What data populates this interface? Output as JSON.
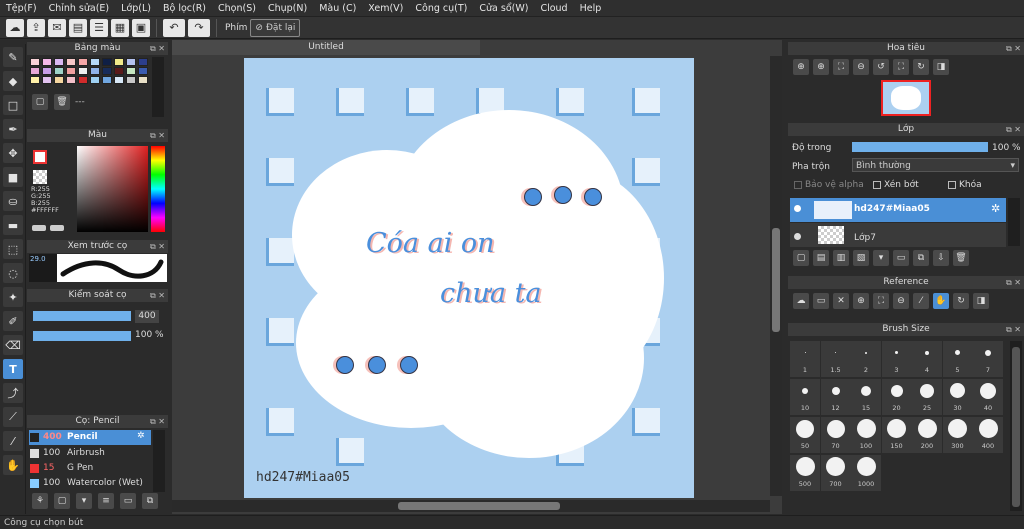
{
  "menu": [
    "Tệp(F)",
    "Chỉnh sửa(E)",
    "Lớp(L)",
    "Bộ lọc(R)",
    "Chọn(S)",
    "Chụp(N)",
    "Màu (C)",
    "Xem(V)",
    "Công cụ(T)",
    "Cửa sổ(W)",
    "Cloud",
    "Help"
  ],
  "toolbar": {
    "phim_label": "Phím",
    "reset_label": "Đặt lại"
  },
  "panels": {
    "palette_title": "Bảng màu",
    "palette_dash": "---",
    "color_title": "Màu",
    "color_values": {
      "r": "R:255",
      "g": "G:255",
      "b": "B:255",
      "hex": "#FFFFFF"
    },
    "brush_preview_title": "Xem trước cọ",
    "brush_preview_size": "29.0",
    "brush_control_title": "Kiểm soát cọ",
    "brush_control": {
      "size": "400",
      "opacity": "100 %"
    },
    "brush_list_title": "Cọ: Pencil",
    "brushes": [
      {
        "size": "400",
        "name": "Pencil",
        "active": true
      },
      {
        "size": "100",
        "name": "Airbrush",
        "active": false
      },
      {
        "size": "15",
        "name": "G Pen",
        "active": false
      },
      {
        "size": "100",
        "name": "Watercolor (Wet)",
        "active": false
      }
    ]
  },
  "canvas": {
    "tab_title": "Untitled",
    "text_line1": "Cóa ai on",
    "text_line2": "chưa ta",
    "watermark": "hd247#Miaa05"
  },
  "navigator": {
    "title": "Hoa tiêu"
  },
  "layers": {
    "title": "Lớp",
    "opacity_label": "Độ trong",
    "opacity_value": "100 %",
    "blend_label": "Pha trộn",
    "blend_value": "Bình thường",
    "protect_alpha": "Bảo vệ alpha",
    "clipping": "Xén bớt",
    "lock": "Khóa",
    "list": [
      {
        "name": "hd247#Miaa05",
        "active": true
      },
      {
        "name": "Lớp7",
        "active": false
      }
    ]
  },
  "reference": {
    "title": "Reference"
  },
  "brush_size": {
    "title": "Brush Size",
    "sizes": [
      "1",
      "1.5",
      "2",
      "3",
      "4",
      "5",
      "7",
      "10",
      "12",
      "15",
      "20",
      "25",
      "30",
      "40",
      "50",
      "70",
      "100",
      "150",
      "200",
      "300",
      "400",
      "500",
      "700",
      "1000"
    ]
  },
  "status": {
    "text": "Công cụ chọn bút"
  },
  "colors": {
    "accent": "#4a8fd6",
    "canvas_bg": "#acd0f0"
  }
}
